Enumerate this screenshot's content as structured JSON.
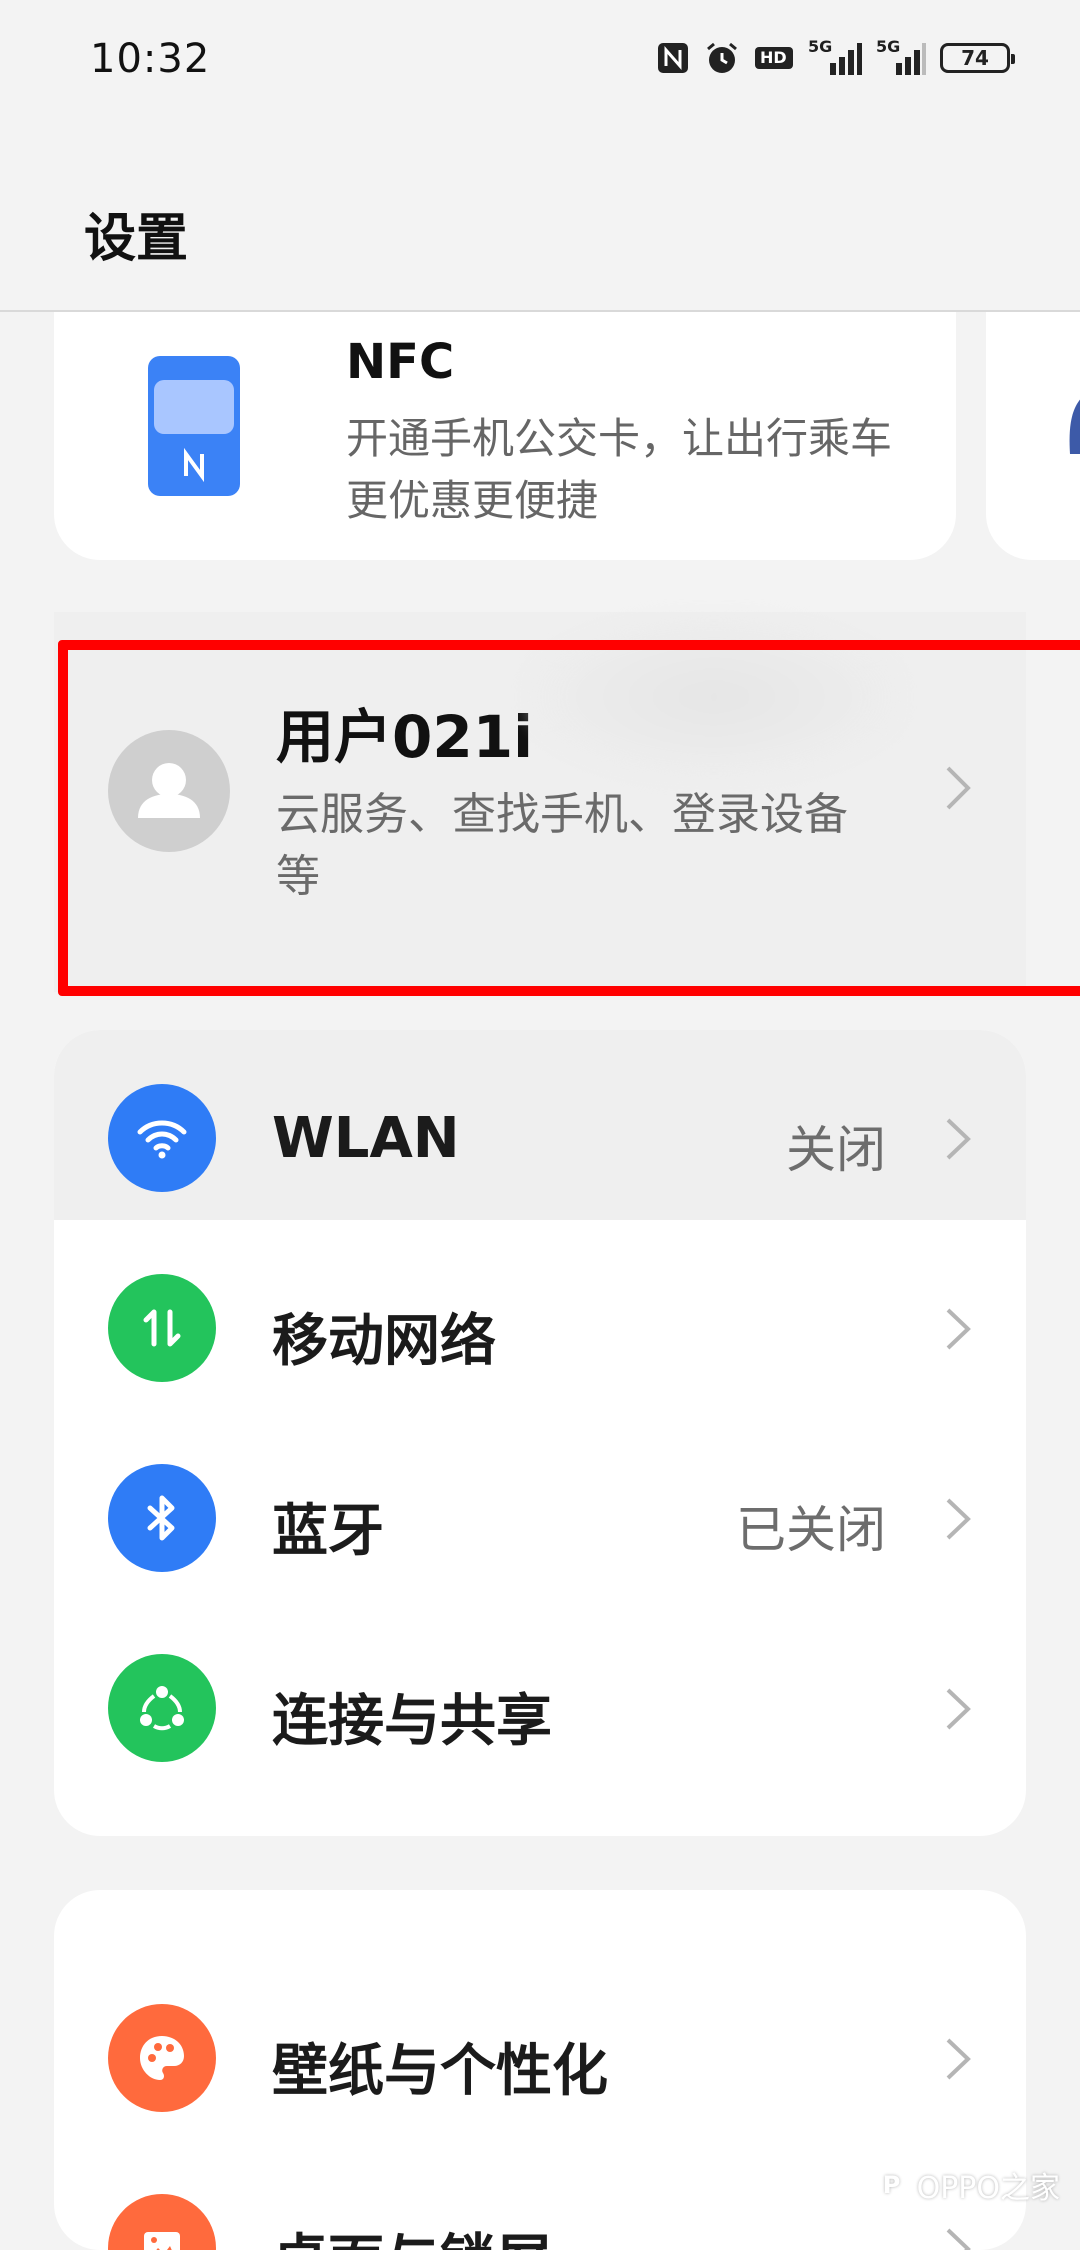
{
  "status_bar": {
    "time": "10:32",
    "icons": [
      "nfc-icon",
      "alarm-icon",
      "hd-icon",
      "signal-5g-icon",
      "signal-5g-icon"
    ],
    "network_label_1": "5G",
    "network_label_2": "5G",
    "hd_label": "HD",
    "battery": "74"
  },
  "header": {
    "title": "设置"
  },
  "nfc_card": {
    "title": "NFC",
    "description": "开通手机公交卡，让出行乘车更优惠更便捷"
  },
  "account": {
    "name": "用户021i",
    "description": "云服务、查找手机、登录设备等"
  },
  "group1": [
    {
      "label": "WLAN",
      "value": "关闭",
      "icon": "wifi-icon",
      "color": "#2f7cf6"
    },
    {
      "label": "移动网络",
      "value": "",
      "icon": "mobile-data-icon",
      "color": "#23c45c"
    },
    {
      "label": "蓝牙",
      "value": "已关闭",
      "icon": "bluetooth-icon",
      "color": "#2f7cf6"
    },
    {
      "label": "连接与共享",
      "value": "",
      "icon": "share-icon",
      "color": "#23c45c"
    }
  ],
  "group2": [
    {
      "label": "壁纸与个性化",
      "value": "",
      "icon": "palette-icon",
      "color": "#ff6a3d"
    },
    {
      "label": "桌面与锁屏",
      "value": "",
      "icon": "image-icon",
      "color": "#ff6a3d"
    }
  ],
  "watermark": {
    "text": "OPPO之家"
  },
  "colors": {
    "highlight": "#ff0000",
    "background": "#f3f3f3"
  }
}
